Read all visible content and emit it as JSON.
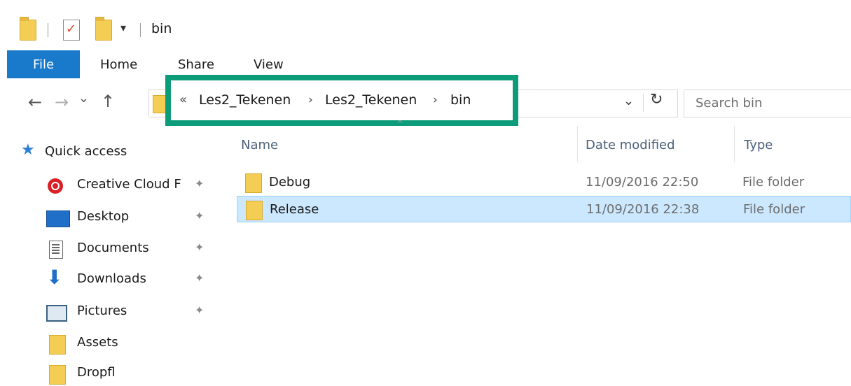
{
  "window": {
    "title": "bin"
  },
  "quick_access_toolbar": {
    "icons": [
      "folder-icon",
      "properties-icon",
      "new-folder-icon",
      "customize-dropdown-icon"
    ],
    "dropdown_glyph": "▾"
  },
  "ribbon": {
    "tabs": [
      {
        "label": "File",
        "active": true
      },
      {
        "label": "Home"
      },
      {
        "label": "Share"
      },
      {
        "label": "View"
      }
    ],
    "file_tab_color": "#1979ca"
  },
  "navigation": {
    "back_glyph": "←",
    "forward_glyph": "→",
    "recent_glyph": "⌄",
    "up_glyph": "↑",
    "address": {
      "overflow_glyph": "«",
      "crumbs": [
        "Les2_Tekenen",
        "Les2_Tekenen",
        "bin"
      ],
      "separator": "›",
      "history_glyph": "⌄",
      "refresh_glyph": "↻",
      "highlight_color": "#0c9c7a"
    },
    "search": {
      "placeholder": "Search bin"
    }
  },
  "columns": [
    "Name",
    "Date modified",
    "Type"
  ],
  "sidebar": {
    "items": [
      {
        "label": "Quick access",
        "icon": "star-icon"
      },
      {
        "label": "Creative Cloud F",
        "icon": "creative-cloud-icon",
        "pinned": true
      },
      {
        "label": "Desktop",
        "icon": "desktop-icon",
        "pinned": true
      },
      {
        "label": "Documents",
        "icon": "documents-icon",
        "pinned": true
      },
      {
        "label": "Downloads",
        "icon": "download-icon",
        "pinned": true
      },
      {
        "label": "Pictures",
        "icon": "pictures-icon",
        "pinned": true
      },
      {
        "label": "Assets",
        "icon": "folder-icon"
      },
      {
        "label": "Dropfl",
        "icon": "folder-icon"
      }
    ],
    "pin_glyph": "📌"
  },
  "files": [
    {
      "name": "Debug",
      "date": "11/09/2016 22:50",
      "type": "File folder",
      "selected": false
    },
    {
      "name": "Release",
      "date": "11/09/2016 22:38",
      "type": "File folder",
      "selected": true
    }
  ]
}
